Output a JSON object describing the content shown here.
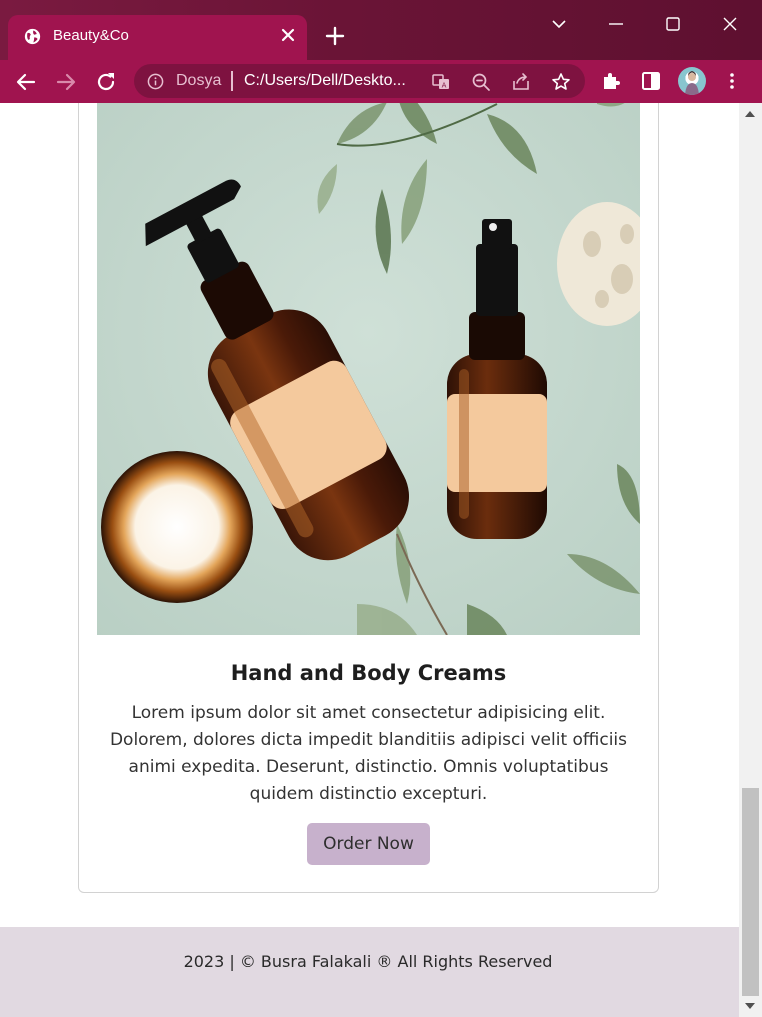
{
  "browser": {
    "tab_title": "Beauty&Co",
    "url_scheme_label": "Dosya",
    "url": "C:/Users/Dell/Deskto...",
    "accent_color": "#a0144f",
    "icons": [
      "globe-icon",
      "close-icon",
      "plus-icon",
      "chevron-down-icon",
      "minimize-icon",
      "maximize-icon",
      "window-close-icon",
      "back-icon",
      "forward-icon",
      "reload-icon",
      "info-icon",
      "translate-icon",
      "zoom-icon",
      "share-icon",
      "star-icon",
      "extensions-icon",
      "side-panel-icon",
      "avatar",
      "more-icon"
    ]
  },
  "product": {
    "title": "Hand and Body Creams",
    "description": "Lorem ipsum dolor sit amet consectetur adipisicing elit. Dolorem, dolores dicta impedit blanditiis adipisci velit officiis animi expedita. Deserunt, distinctio. Omnis voluptatibus quidem distinctio excepturi.",
    "button_label": "Order Now",
    "button_color": "#c7b1cc"
  },
  "footer": {
    "text": "2023 | © Busra Falakali ® All Rights Reserved",
    "background": "#e1d9e1"
  }
}
